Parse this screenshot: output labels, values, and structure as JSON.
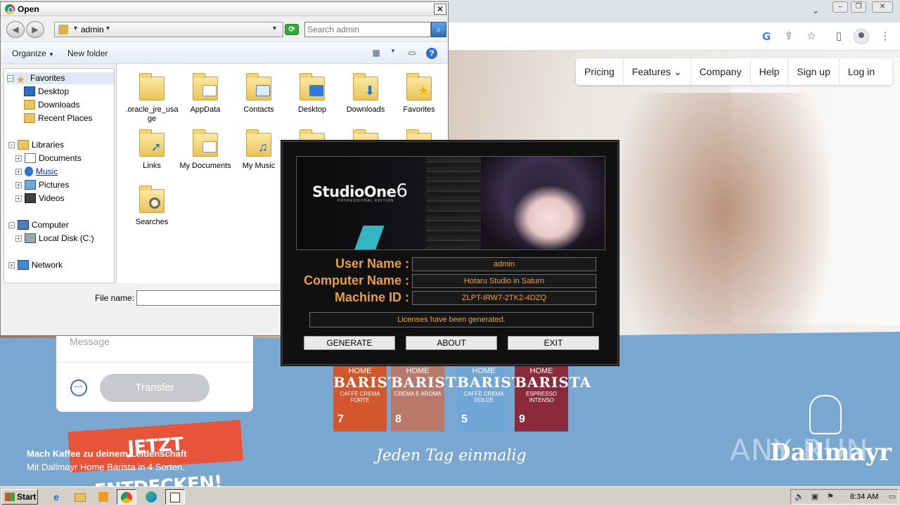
{
  "browser": {
    "site_nav": [
      "Pricing",
      "Features",
      "Company",
      "Help",
      "Sign up",
      "Log in"
    ],
    "message_placeholder": "Message",
    "transfer_button": "Transfer",
    "promo": {
      "badge": "JETZT ENTDECKEN!",
      "line1": "Mach Kaffee zu deinem Leidenschaft",
      "line2": "Mit Dallmayr Home Barista in 4 Sorten."
    },
    "packs": [
      {
        "home": "HOME",
        "brand": "BARISTA",
        "variant": "CAFFÈ CREMA FORTE",
        "number": "7",
        "color": "#d2572d"
      },
      {
        "home": "HOME",
        "brand": "BARISTA",
        "variant": "CREMA E AROMA",
        "number": "8",
        "color": "#b8796b"
      },
      {
        "home": "HOME",
        "brand": "BARISTA",
        "variant": "CAFFÈ CREMA DOLCE",
        "number": "5",
        "color": "#6fa6d6"
      },
      {
        "home": "HOME",
        "brand": "BARISTA",
        "variant": "ESPRESSO INTENSO",
        "number": "9",
        "color": "#8a2a3a"
      }
    ],
    "tagline": "Jeden Tag einmalig",
    "brand": "Dallmayr",
    "watermark": "ANY RUN"
  },
  "open_dialog": {
    "title": "Open",
    "address": "admin",
    "search_placeholder": "Search admin",
    "organize": "Organize",
    "new_folder": "New folder",
    "nav_tree": [
      {
        "label": "Favorites",
        "icon": "star-icon"
      },
      {
        "label": "Desktop",
        "icon": "desktop-icon"
      },
      {
        "label": "Downloads",
        "icon": "folder-icon"
      },
      {
        "label": "Recent Places",
        "icon": "folder-icon"
      },
      {
        "label": "Libraries",
        "icon": "folder-icon"
      },
      {
        "label": "Documents",
        "icon": "documents-icon"
      },
      {
        "label": "Music",
        "icon": "music-icon"
      },
      {
        "label": "Pictures",
        "icon": "pictures-icon"
      },
      {
        "label": "Videos",
        "icon": "videos-icon"
      },
      {
        "label": "Computer",
        "icon": "computer-icon"
      },
      {
        "label": "Local Disk (C:)",
        "icon": "disk-icon"
      },
      {
        "label": "Network",
        "icon": "network-icon"
      }
    ],
    "files": [
      {
        "name": ".oracle_jre_usage",
        "badge": ""
      },
      {
        "name": "AppData",
        "badge": "paper"
      },
      {
        "name": "Contacts",
        "badge": "card"
      },
      {
        "name": "Desktop",
        "badge": "blue"
      },
      {
        "name": "Downloads",
        "badge": "arrow"
      },
      {
        "name": "Favorites",
        "badge": "star"
      },
      {
        "name": "Links",
        "badge": "arrow"
      },
      {
        "name": "My Documents",
        "badge": "paper"
      },
      {
        "name": "My Music",
        "badge": "note"
      },
      {
        "name": "Searches",
        "badge": "glass"
      }
    ],
    "file_name_label": "File name:",
    "file_name_value": ""
  },
  "keygen": {
    "logo": "StudioOne",
    "logo_number": "6",
    "logo_sub": "PROFESSIONAL EDITION",
    "user_name_label": "User Name :",
    "user_name": "admin",
    "computer_name_label": "Computer Name :",
    "computer_name": "Hotaru Studio in Saturn",
    "machine_id_label": "Machine ID :",
    "machine_id": "ZLPT-IRW7-2TK2-4DZQ",
    "status": "Licenses have been generated.",
    "buttons": [
      "GENERATE",
      "ABOUT",
      "EXIT"
    ]
  },
  "taskbar": {
    "start": "Start",
    "clock": "8:34 AM"
  }
}
